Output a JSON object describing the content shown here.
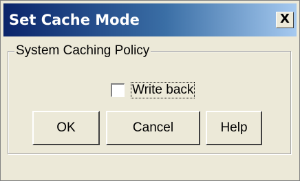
{
  "dialog": {
    "title": "Set Cache Mode",
    "close_label": "X"
  },
  "group": {
    "legend": "System Caching Policy"
  },
  "write_back": {
    "label": "Write back",
    "checked": false
  },
  "buttons": {
    "ok": "OK",
    "cancel": "Cancel",
    "help": "Help"
  },
  "colors": {
    "title_bar_start": "#0a246a",
    "title_bar_end": "#a6caf0",
    "dialog_background": "#ece9d8"
  }
}
